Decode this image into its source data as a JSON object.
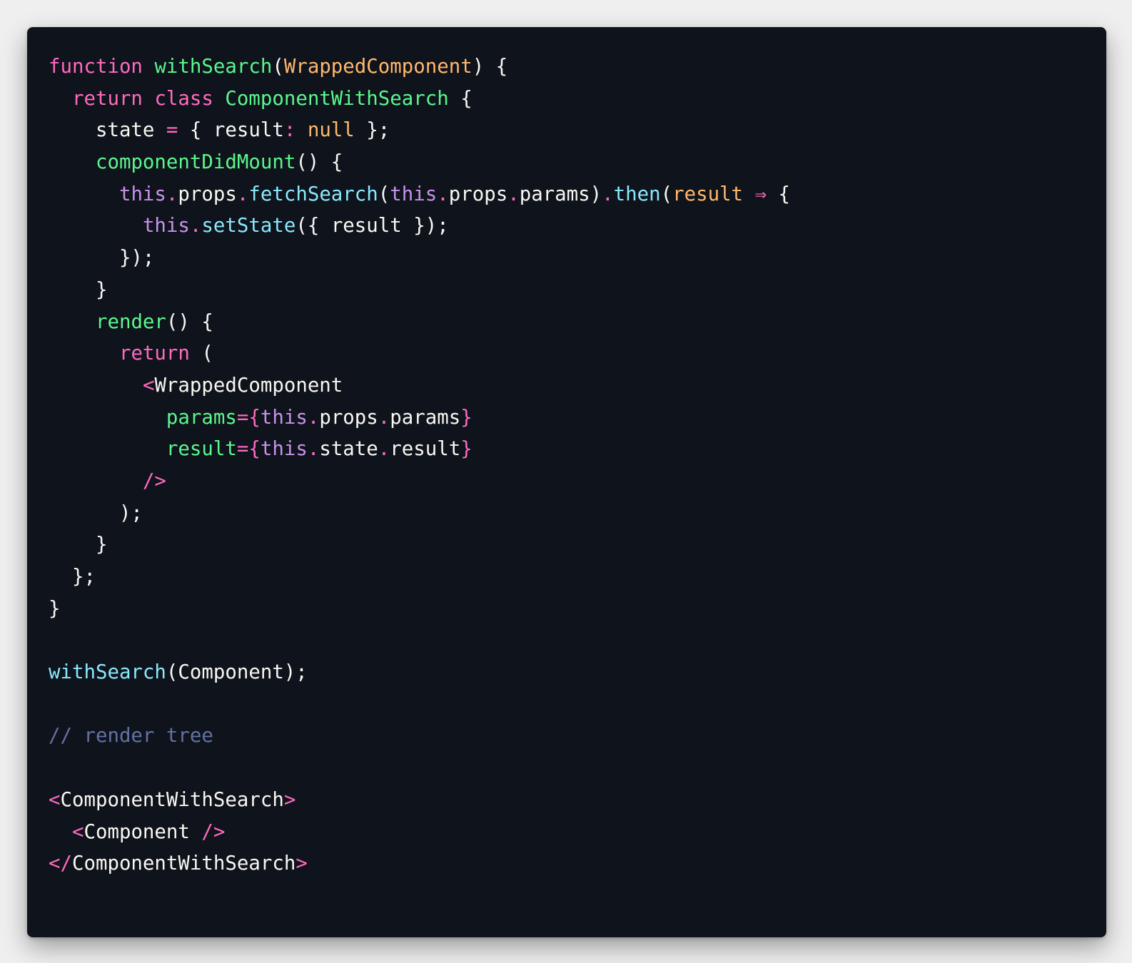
{
  "editor": {
    "language": "javascript-jsx",
    "theme_colors": {
      "background": "#0f131b",
      "page_background": "#efefef",
      "keyword": "#ff6ac1",
      "function": "#5af78e",
      "parameter": "#ffb86c",
      "this": "#c792ea",
      "method": "#8be9fd",
      "comment": "#6272a4",
      "text": "#f8f8f2"
    },
    "lines": [
      [
        [
          "kw",
          "function"
        ],
        [
          "txt",
          " "
        ],
        [
          "fn",
          "withSearch"
        ],
        [
          "txt",
          "("
        ],
        [
          "par",
          "WrappedComponent"
        ],
        [
          "txt",
          ") {"
        ]
      ],
      [
        [
          "txt",
          "  "
        ],
        [
          "kw",
          "return"
        ],
        [
          "txt",
          " "
        ],
        [
          "kw",
          "class"
        ],
        [
          "txt",
          " "
        ],
        [
          "cls",
          "ComponentWithSearch"
        ],
        [
          "txt",
          " {"
        ]
      ],
      [
        [
          "txt",
          "    state "
        ],
        [
          "pu",
          "="
        ],
        [
          "txt",
          " { result"
        ],
        [
          "pu",
          ":"
        ],
        [
          "txt",
          " "
        ],
        [
          "par",
          "null"
        ],
        [
          "txt",
          " };"
        ]
      ],
      [
        [
          "txt",
          "    "
        ],
        [
          "fn",
          "componentDidMount"
        ],
        [
          "txt",
          "() {"
        ]
      ],
      [
        [
          "txt",
          "      "
        ],
        [
          "this",
          "this"
        ],
        [
          "pu",
          "."
        ],
        [
          "txt",
          "props"
        ],
        [
          "pu",
          "."
        ],
        [
          "meth",
          "fetchSearch"
        ],
        [
          "txt",
          "("
        ],
        [
          "this",
          "this"
        ],
        [
          "pu",
          "."
        ],
        [
          "txt",
          "props"
        ],
        [
          "pu",
          "."
        ],
        [
          "txt",
          "params)"
        ],
        [
          "pu",
          "."
        ],
        [
          "meth",
          "then"
        ],
        [
          "txt",
          "("
        ],
        [
          "par",
          "result"
        ],
        [
          "txt",
          " "
        ],
        [
          "pu",
          "⇒"
        ],
        [
          "txt",
          " {"
        ]
      ],
      [
        [
          "txt",
          "        "
        ],
        [
          "this",
          "this"
        ],
        [
          "pu",
          "."
        ],
        [
          "meth",
          "setState"
        ],
        [
          "txt",
          "({ result });"
        ]
      ],
      [
        [
          "txt",
          "      });"
        ]
      ],
      [
        [
          "txt",
          "    }"
        ]
      ],
      [
        [
          "txt",
          "    "
        ],
        [
          "fn",
          "render"
        ],
        [
          "txt",
          "() {"
        ]
      ],
      [
        [
          "txt",
          "      "
        ],
        [
          "kw",
          "return"
        ],
        [
          "txt",
          " ("
        ]
      ],
      [
        [
          "txt",
          "        "
        ],
        [
          "tag",
          "<"
        ],
        [
          "txt",
          "WrappedComponent"
        ]
      ],
      [
        [
          "txt",
          "          "
        ],
        [
          "attr",
          "params"
        ],
        [
          "pu",
          "="
        ],
        [
          "tag",
          "{"
        ],
        [
          "this",
          "this"
        ],
        [
          "pu",
          "."
        ],
        [
          "txt",
          "props"
        ],
        [
          "pu",
          "."
        ],
        [
          "txt",
          "params"
        ],
        [
          "tag",
          "}"
        ]
      ],
      [
        [
          "txt",
          "          "
        ],
        [
          "attr",
          "result"
        ],
        [
          "pu",
          "="
        ],
        [
          "tag",
          "{"
        ],
        [
          "this",
          "this"
        ],
        [
          "pu",
          "."
        ],
        [
          "txt",
          "state"
        ],
        [
          "pu",
          "."
        ],
        [
          "txt",
          "result"
        ],
        [
          "tag",
          "}"
        ]
      ],
      [
        [
          "txt",
          "        "
        ],
        [
          "tag",
          "/>"
        ]
      ],
      [
        [
          "txt",
          "      );"
        ]
      ],
      [
        [
          "txt",
          "    }"
        ]
      ],
      [
        [
          "txt",
          "  };"
        ]
      ],
      [
        [
          "txt",
          "}"
        ]
      ],
      [],
      [
        [
          "meth",
          "withSearch"
        ],
        [
          "txt",
          "(Component);"
        ]
      ],
      [],
      [
        [
          "cmt",
          "// render tree"
        ]
      ],
      [],
      [
        [
          "tag",
          "<"
        ],
        [
          "txt",
          "ComponentWithSearch"
        ],
        [
          "tag",
          ">"
        ]
      ],
      [
        [
          "txt",
          "  "
        ],
        [
          "tag",
          "<"
        ],
        [
          "txt",
          "Component "
        ],
        [
          "tag",
          "/>"
        ]
      ],
      [
        [
          "tag",
          "</"
        ],
        [
          "txt",
          "ComponentWithSearch"
        ],
        [
          "tag",
          ">"
        ]
      ]
    ]
  }
}
